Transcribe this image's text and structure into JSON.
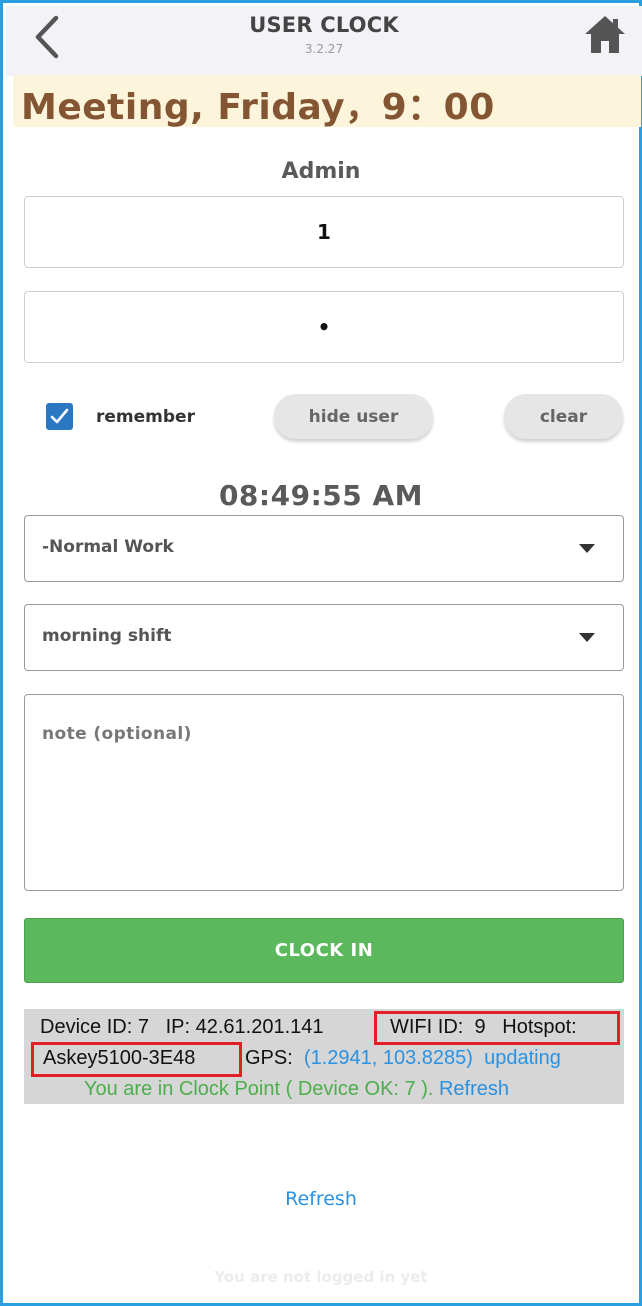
{
  "header": {
    "title": "USER CLOCK",
    "version": "3.2.27",
    "back_icon": "chevron-left-icon",
    "home_icon": "home-icon"
  },
  "banner": {
    "text": "Meeting, Friday，9：00",
    "color": "#845532",
    "background": "#fcf5dc"
  },
  "login": {
    "user_label": "Admin",
    "user_value": "1",
    "password_value": "•",
    "remember_label": "remember",
    "remember_checked": true,
    "hide_user_label": "hide user",
    "clear_label": "clear"
  },
  "clock": {
    "time": "08:49:55 AM"
  },
  "form": {
    "work_type": "-Normal Work",
    "shift": "morning shift",
    "note_placeholder": "note (optional)",
    "clock_in_label": "CLOCK IN",
    "clock_in_color": "#5cb85c"
  },
  "device_info": {
    "device_id_label": "Device ID:",
    "device_id": "7",
    "ip_label": "IP:",
    "ip": "42.61.201.141",
    "wifi_id_label": "WIFI ID:",
    "wifi_id": "9",
    "hotspot_label": "Hotspot:",
    "hotspot": "Askey5100-3E48",
    "gps_label": "GPS:",
    "gps": "(1.2941, 103.8285)",
    "gps_status": "updating",
    "status_message": "You are in Clock Point ( Device OK: 7 ).",
    "status_refresh": "Refresh",
    "highlight_color": "#e01f26"
  },
  "footer": {
    "refresh_label": "Refresh",
    "login_status": "You are not logged in yet"
  }
}
